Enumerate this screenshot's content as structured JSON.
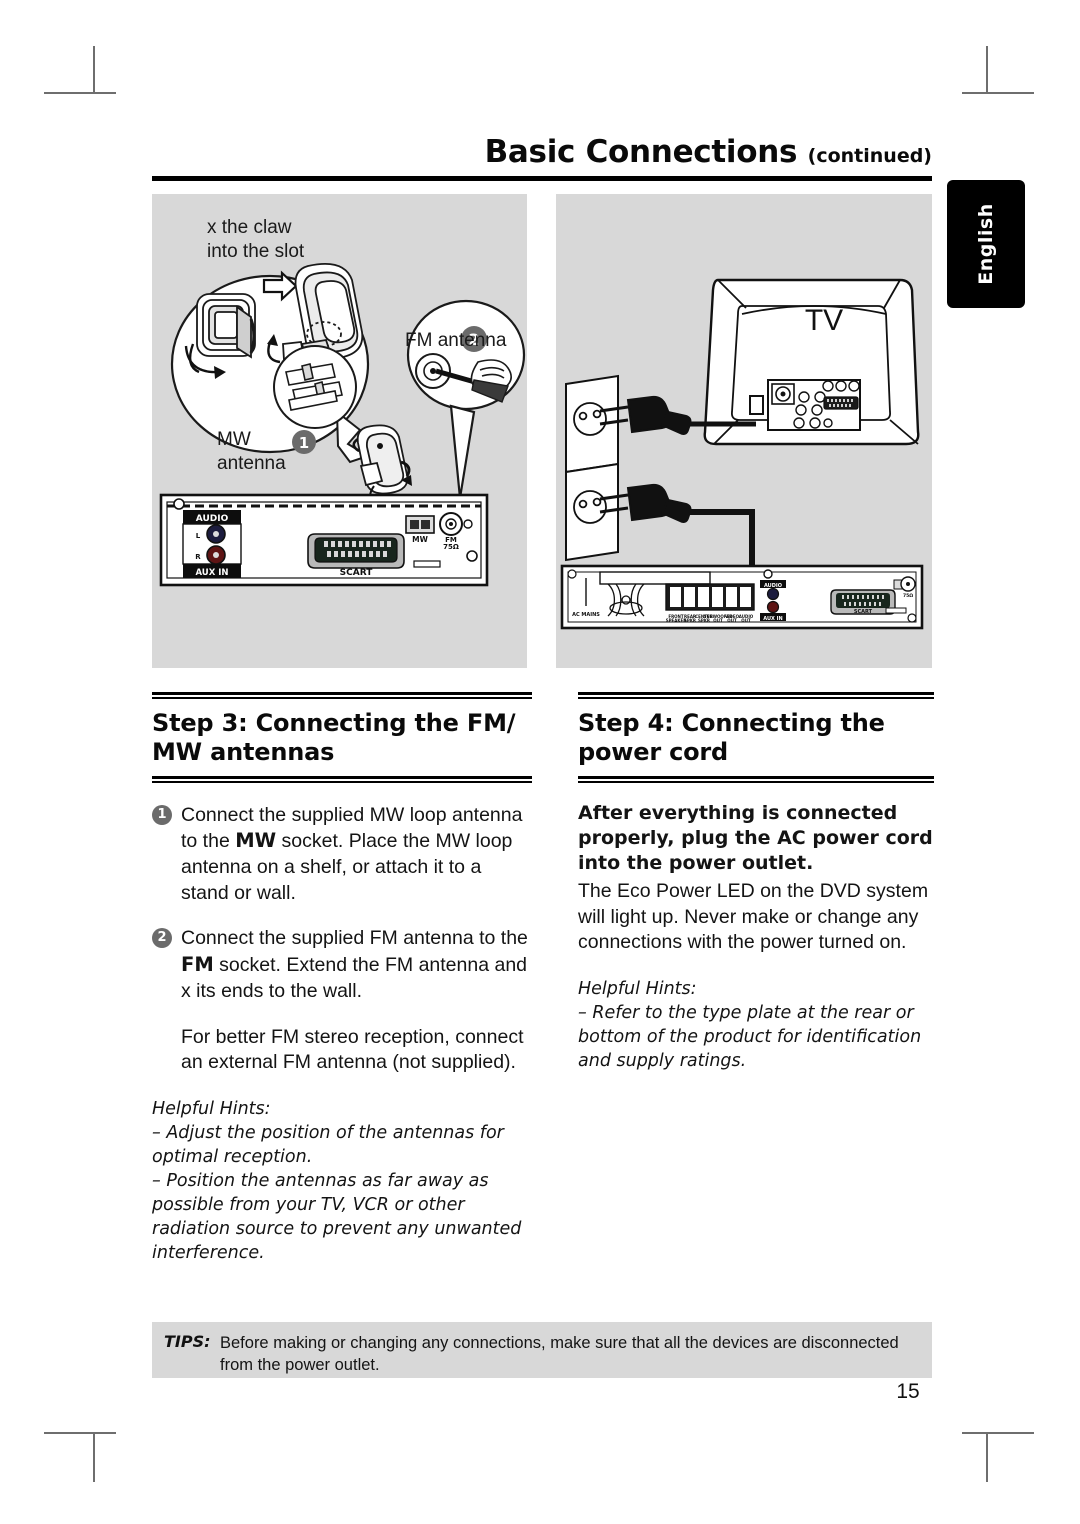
{
  "header": {
    "title": "Basic Connections",
    "title_suffix": "(continued)"
  },
  "language_tab": {
    "label": "English"
  },
  "illustrations": {
    "left": {
      "name": "fm-mw-antenna-connection-diagram",
      "labels": {
        "claw_slot": "x the claw\ninto the slot",
        "fm_antenna": "FM antenna",
        "mw_antenna": "MW\nantenna"
      },
      "callout_numbers": [
        "1",
        "2"
      ],
      "rear_panel_labels": {
        "audio": "AUDIO",
        "left_channel": "L",
        "right_channel": "R",
        "aux_in": "AUX IN",
        "scart": "SCART",
        "mw": "MW",
        "fm": "FM\n75Ω"
      }
    },
    "right": {
      "name": "power-cord-connection-diagram",
      "labels": {
        "tv": "TV"
      }
    }
  },
  "columns": {
    "left": {
      "step_heading": "Step 3:  Connecting the FM/ MW antennas",
      "items": [
        {
          "marker": "1",
          "segments": [
            {
              "text": "Connect the supplied MW loop antenna to the ",
              "bold": false
            },
            {
              "text": "MW",
              "bold": true
            },
            {
              "text": " socket.  Place the MW loop antenna on a shelf, or attach it to a stand or wall.",
              "bold": false
            }
          ]
        },
        {
          "marker": "2",
          "segments": [
            {
              "text": "Connect the supplied FM antenna to the ",
              "bold": false
            },
            {
              "text": "FM",
              "bold": true
            },
            {
              "text": " socket.  Extend the FM antenna and  x its ends to the wall.",
              "bold": false
            }
          ]
        }
      ],
      "extra_paragraph": "For better FM stereo reception, connect an external FM antenna (not supplied).",
      "hints": {
        "title": "Helpful Hints:",
        "lines": [
          "–  Adjust the position of the antennas for optimal reception.",
          "–  Position the antennas as far away as possible from your TV, VCR or other radiation source to prevent any unwanted interference."
        ]
      }
    },
    "right": {
      "step_heading": "Step 4:  Connecting the power cord",
      "bold_intro": "After everything is connected properly, plug the AC power cord into the power outlet.",
      "body": "The Eco Power LED on the DVD system will light up. Never make or change any connections with the power turned on.",
      "hints": {
        "title": "Helpful Hints:",
        "lines": [
          "–  Refer to the type plate at the rear or bottom of the product for identification and supply ratings."
        ]
      }
    }
  },
  "tips": {
    "label": "TIPS:",
    "text": "Before making or changing any connections, make sure that all the devices are disconnected from the power outlet."
  },
  "page_number": "15",
  "colors": {
    "panel_background": "#d8d8d8",
    "tab_background": "#000000",
    "marker_fill": "#6b6b6b",
    "text": "#141414"
  }
}
